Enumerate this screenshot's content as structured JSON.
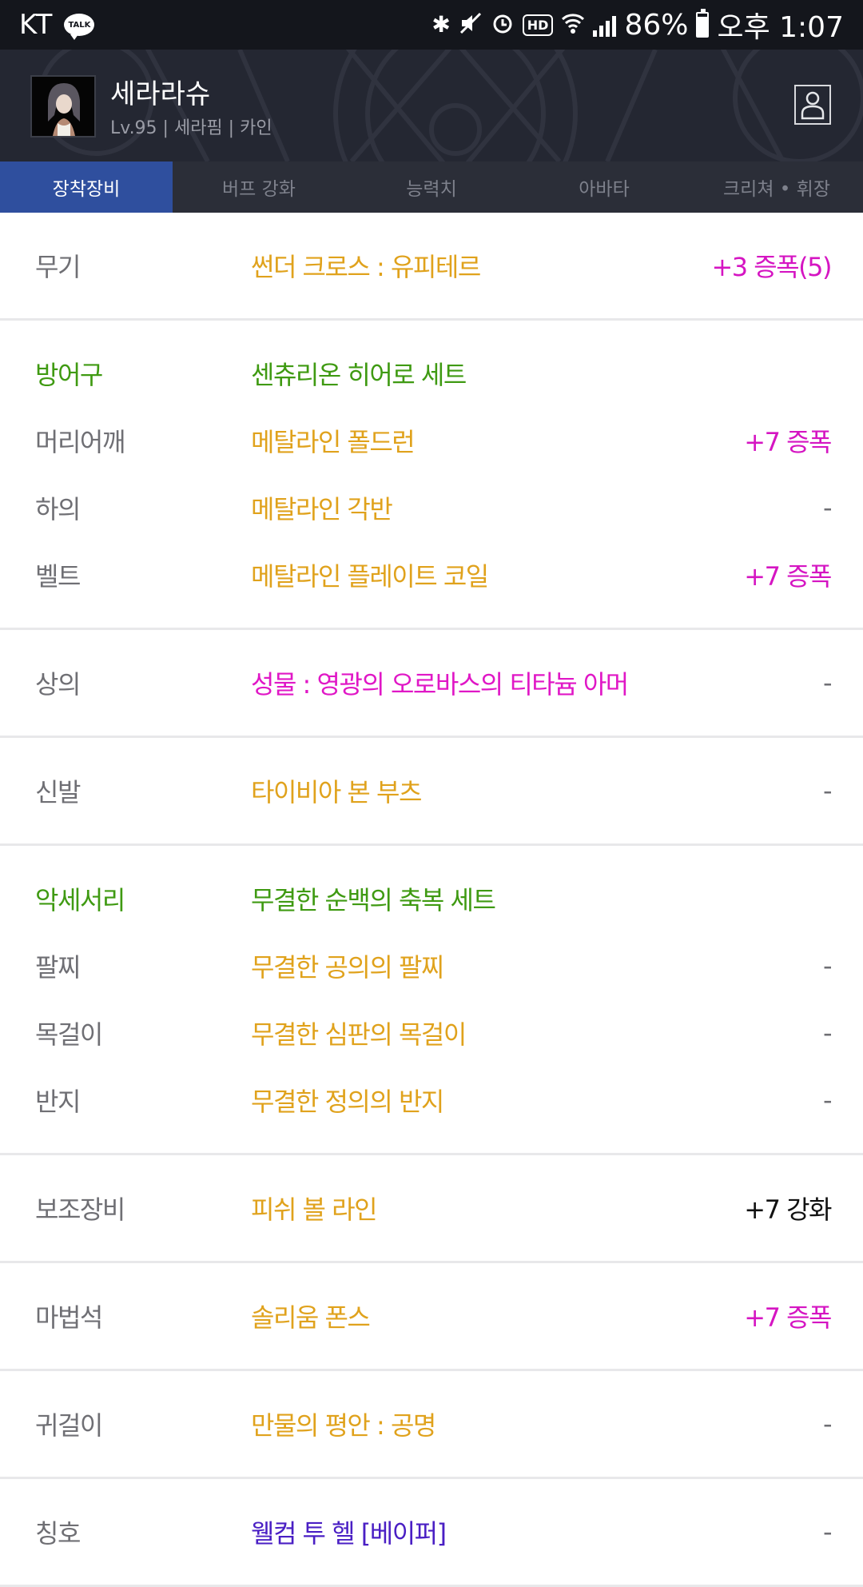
{
  "status_bar": {
    "carrier": "KT",
    "talk_label": "TALK",
    "battery": "86%",
    "battery_level": 0.86,
    "time": "오후 1:07"
  },
  "header": {
    "name": "세라라슈",
    "subtitle": "Lv.95 | 세라핌 | 카인"
  },
  "tabs": [
    {
      "label": "장착장비",
      "active": true
    },
    {
      "label": "버프 강화",
      "active": false
    },
    {
      "label": "능력치",
      "active": false
    },
    {
      "label": "아바타",
      "active": false
    },
    {
      "label": "크리쳐 • 휘장",
      "active": false
    }
  ],
  "colors": {
    "slot": "#6f6f74",
    "set_green": "#3f9a12",
    "item_orange": "#e0a21c",
    "item_magenta": "#e017c6",
    "item_purple": "#4a1fc4",
    "upgrade_magenta": "#d515c2",
    "dash": "#6f6f74",
    "refine_black": "#111111",
    "tab_active": "#2f4f9e"
  },
  "equipment": [
    {
      "rows": [
        {
          "slot": "무기",
          "item": "썬더 크로스 : 유피테르",
          "extra": "+3 증폭(5)",
          "slot_color": "#6f6f74",
          "item_color": "#e0a21c",
          "extra_color": "#d515c2"
        }
      ]
    },
    {
      "rows": [
        {
          "slot": "방어구",
          "item": "센츄리온 히어로 세트",
          "extra": "",
          "slot_color": "#3f9a12",
          "item_color": "#3f9a12",
          "extra_color": "#6f6f74"
        },
        {
          "slot": "머리어깨",
          "item": "메탈라인 폴드런",
          "extra": "+7 증폭",
          "slot_color": "#6f6f74",
          "item_color": "#e0a21c",
          "extra_color": "#d515c2"
        },
        {
          "slot": "하의",
          "item": "메탈라인 각반",
          "extra": "-",
          "slot_color": "#6f6f74",
          "item_color": "#e0a21c",
          "extra_color": "#6f6f74"
        },
        {
          "slot": "벨트",
          "item": "메탈라인 플레이트 코일",
          "extra": "+7 증폭",
          "slot_color": "#6f6f74",
          "item_color": "#e0a21c",
          "extra_color": "#d515c2"
        }
      ]
    },
    {
      "rows": [
        {
          "slot": "상의",
          "item": "성물 : 영광의 오로바스의 티타늄 아머",
          "extra": "-",
          "slot_color": "#6f6f74",
          "item_color": "#e017c6",
          "extra_color": "#6f6f74"
        }
      ]
    },
    {
      "rows": [
        {
          "slot": "신발",
          "item": "타이비아 본 부츠",
          "extra": "-",
          "slot_color": "#6f6f74",
          "item_color": "#e0a21c",
          "extra_color": "#6f6f74"
        }
      ]
    },
    {
      "rows": [
        {
          "slot": "악세서리",
          "item": "무결한 순백의 축복 세트",
          "extra": "",
          "slot_color": "#3f9a12",
          "item_color": "#3f9a12",
          "extra_color": "#6f6f74"
        },
        {
          "slot": "팔찌",
          "item": "무결한 공의의 팔찌",
          "extra": "-",
          "slot_color": "#6f6f74",
          "item_color": "#e0a21c",
          "extra_color": "#6f6f74"
        },
        {
          "slot": "목걸이",
          "item": "무결한 심판의 목걸이",
          "extra": "-",
          "slot_color": "#6f6f74",
          "item_color": "#e0a21c",
          "extra_color": "#6f6f74"
        },
        {
          "slot": "반지",
          "item": "무결한 정의의 반지",
          "extra": "-",
          "slot_color": "#6f6f74",
          "item_color": "#e0a21c",
          "extra_color": "#6f6f74"
        }
      ]
    },
    {
      "rows": [
        {
          "slot": "보조장비",
          "item": "피쉬 볼 라인",
          "extra": "+7 강화",
          "slot_color": "#6f6f74",
          "item_color": "#e0a21c",
          "extra_color": "#111111"
        }
      ]
    },
    {
      "rows": [
        {
          "slot": "마법석",
          "item": "솔리움 폰스",
          "extra": "+7 증폭",
          "slot_color": "#6f6f74",
          "item_color": "#e0a21c",
          "extra_color": "#d515c2"
        }
      ]
    },
    {
      "rows": [
        {
          "slot": "귀걸이",
          "item": "만물의 평안 : 공명",
          "extra": "-",
          "slot_color": "#6f6f74",
          "item_color": "#e0a21c",
          "extra_color": "#6f6f74"
        }
      ]
    },
    {
      "rows": [
        {
          "slot": "칭호",
          "item": "웰컴 투 헬 [베이퍼]",
          "extra": "-",
          "slot_color": "#6f6f74",
          "item_color": "#4a1fc4",
          "extra_color": "#6f6f74"
        }
      ]
    }
  ]
}
